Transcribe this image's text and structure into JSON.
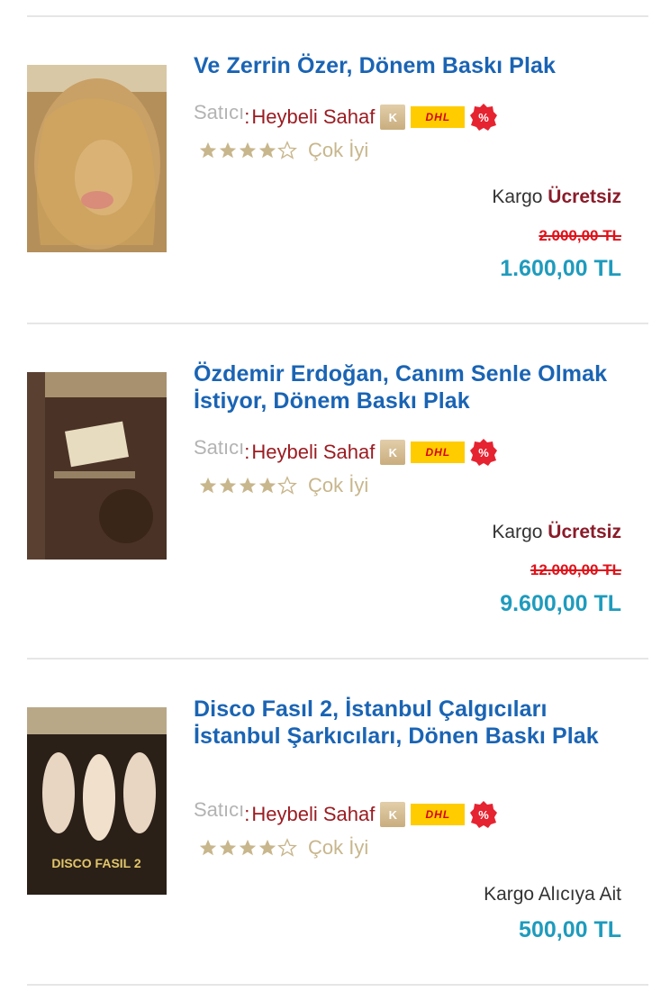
{
  "products": [
    {
      "title": "Ve Zerrin Özer, Dönem Baskı Plak",
      "seller_label": "Satıcı",
      "seller_colon": ":",
      "seller_name": "Heybeli Sahaf",
      "rating": 4,
      "rating_label": "Çok İyi",
      "shipping_prefix": "Kargo",
      "shipping_value": "Ücretsiz",
      "old_price": "2.000,00 TL",
      "price": "1.600,00 TL"
    },
    {
      "title": "Özdemir Erdoğan, Canım Senle Olmak İstiyor, Dönem Baskı Plak",
      "seller_label": "Satıcı",
      "seller_colon": ":",
      "seller_name": "Heybeli Sahaf",
      "rating": 4,
      "rating_label": "Çok İyi",
      "shipping_prefix": "Kargo",
      "shipping_value": "Ücretsiz",
      "old_price": "12.000,00 TL",
      "price": "9.600,00 TL"
    },
    {
      "title": "Disco Fasıl 2, İstanbul Çalgıcıları İstanbul Şarkıcıları, Dönen Baskı Plak",
      "seller_label": "Satıcı",
      "seller_colon": ":",
      "seller_name": "Heybeli Sahaf",
      "rating": 4,
      "rating_label": "Çok İyi",
      "shipping_prefix": "Kargo Alıcıya Ait",
      "shipping_value": "",
      "old_price": "",
      "price": "500,00 TL"
    }
  ],
  "badges": {
    "k_letter": "K",
    "dhl_text": "DHL"
  },
  "covers": {
    "disco_cover_text": "DISCO FASIL 2"
  },
  "colors": {
    "title": "#1a64b4",
    "seller": "#9b1c22",
    "price": "#1f9bbd",
    "old_price": "#e0121a",
    "star": "#c8b68c"
  }
}
